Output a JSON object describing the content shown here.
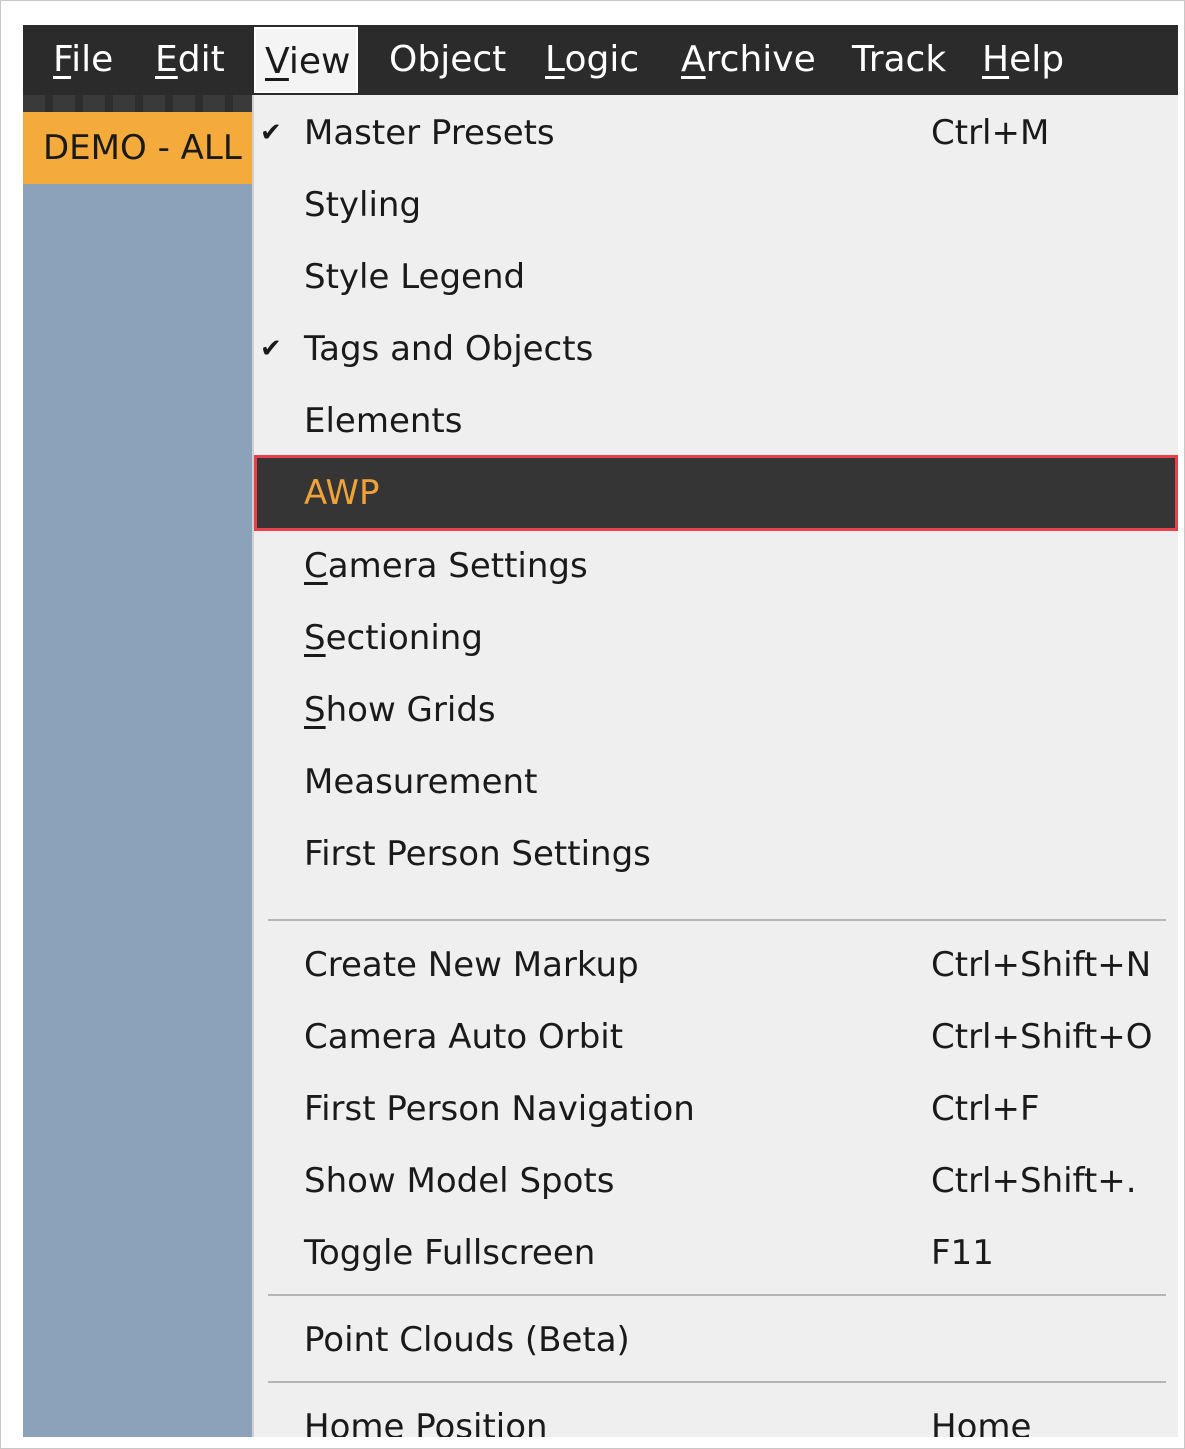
{
  "menubar": {
    "items": [
      {
        "label": "File",
        "mnemonic": "F"
      },
      {
        "label": "Edit",
        "mnemonic": "E"
      },
      {
        "label": "View",
        "mnemonic": "V",
        "active": true
      },
      {
        "label": "Object",
        "mnemonic": ""
      },
      {
        "label": "Logic",
        "mnemonic": "L"
      },
      {
        "label": "Archive",
        "mnemonic": "A"
      },
      {
        "label": "Track",
        "mnemonic": ""
      },
      {
        "label": "Help",
        "mnemonic": "H"
      }
    ]
  },
  "project_tab": {
    "label": "DEMO - ALL I"
  },
  "view_menu": {
    "items": [
      {
        "label": "Master Presets",
        "shortcut": "Ctrl+M",
        "checked": true
      },
      {
        "label": "Styling",
        "shortcut": "",
        "checked": false
      },
      {
        "label": "Style Legend",
        "shortcut": "",
        "checked": false
      },
      {
        "label": "Tags and Objects",
        "shortcut": "",
        "checked": true
      },
      {
        "label": "Elements",
        "shortcut": "",
        "checked": false
      },
      {
        "label": "AWP",
        "shortcut": "",
        "checked": false,
        "highlighted": true
      },
      {
        "label": "Camera Settings",
        "shortcut": "",
        "mnemonic": "C"
      },
      {
        "label": "Sectioning",
        "shortcut": "",
        "mnemonic": "S"
      },
      {
        "label": "Show Grids",
        "shortcut": "",
        "mnemonic": "S"
      },
      {
        "label": "Measurement",
        "shortcut": ""
      },
      {
        "label": "First Person Settings",
        "shortcut": ""
      },
      {
        "label": "Create New Markup",
        "shortcut": "Ctrl+Shift+N"
      },
      {
        "label": "Camera Auto Orbit",
        "shortcut": "Ctrl+Shift+O"
      },
      {
        "label": "First Person Navigation",
        "shortcut": "Ctrl+F"
      },
      {
        "label": "Show Model Spots",
        "shortcut": "Ctrl+Shift+."
      },
      {
        "label": "Toggle Fullscreen",
        "shortcut": "F11"
      },
      {
        "label": "Point Clouds (Beta)",
        "shortcut": ""
      },
      {
        "label": "Home Position",
        "shortcut": "Home"
      }
    ],
    "check_glyph": "✔"
  },
  "colors": {
    "menubar_bg": "#2b2b2b",
    "highlight_bg": "#353535",
    "highlight_border": "#e8414a",
    "highlight_text": "#f0a23a",
    "project_tab_bg": "#f5ab3b",
    "workspace_bg": "#8ba2ba"
  }
}
